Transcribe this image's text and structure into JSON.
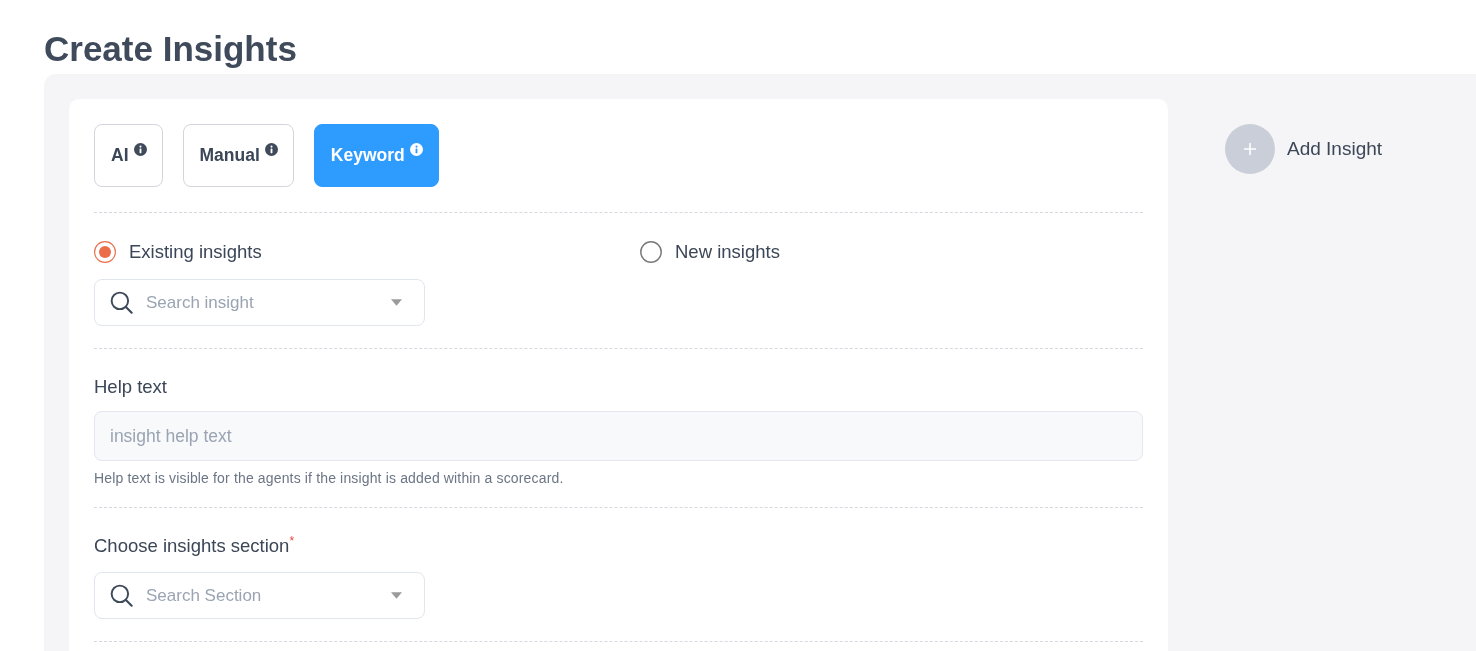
{
  "page": {
    "title": "Create Insights"
  },
  "modes": [
    {
      "label": "AI",
      "selected": false
    },
    {
      "label": "Manual",
      "selected": false
    },
    {
      "label": "Keyword",
      "selected": true
    }
  ],
  "insight_source": [
    {
      "label": "Existing insights",
      "selected": true
    },
    {
      "label": "New insights",
      "selected": false
    }
  ],
  "insight_search": {
    "placeholder": "Search insight"
  },
  "help_text": {
    "label": "Help text",
    "placeholder": "insight help text",
    "hint": "Help text is visible for the agents if the insight is added within a scorecard."
  },
  "section": {
    "label": "Choose insights section$^{*}$",
    "search": {
      "placeholder": "Search Section"
    }
  },
  "add_insight": {
    "label": "Add Insight"
  }
}
